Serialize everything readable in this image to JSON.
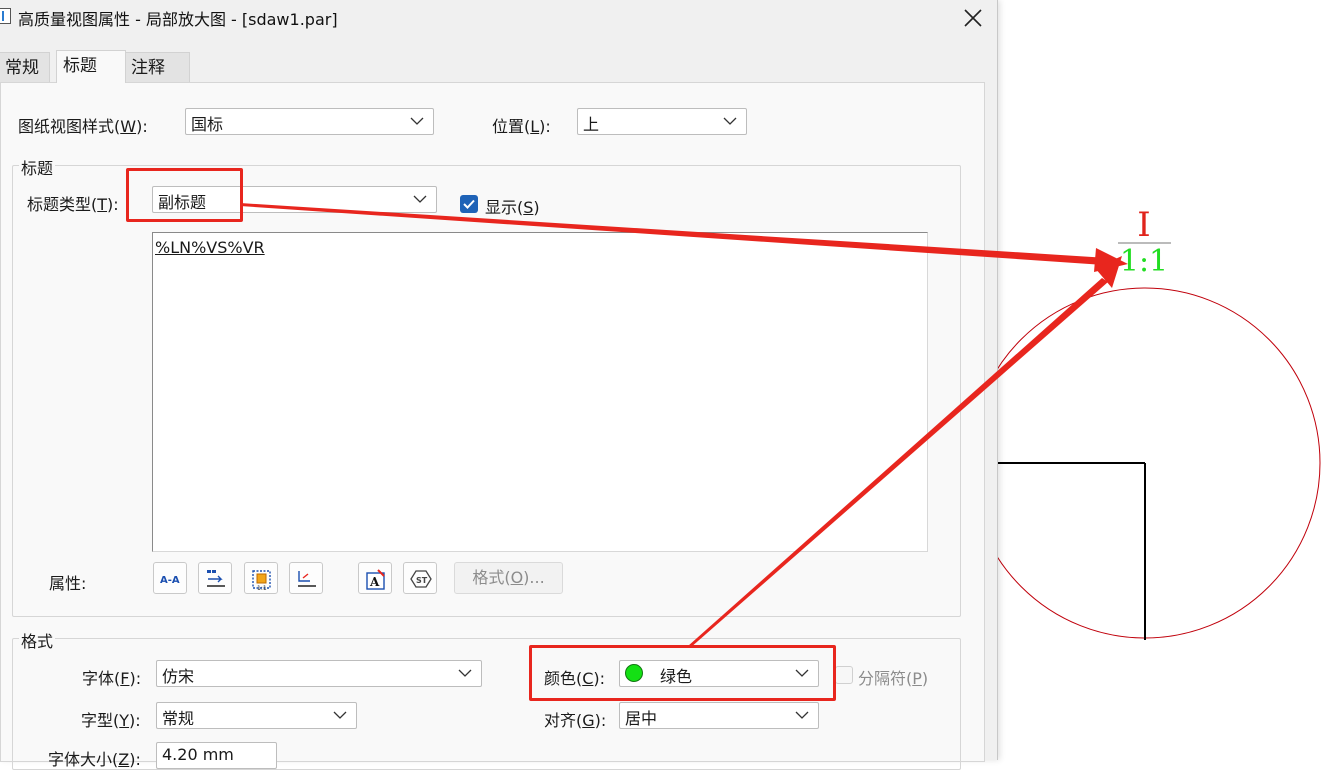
{
  "window": {
    "title": "高质量视图属性 - 局部放大图 - [sdaw1.par]"
  },
  "tabs": [
    {
      "label": "常规",
      "active": false
    },
    {
      "label": "标题",
      "active": true
    },
    {
      "label": "注释",
      "active": false
    }
  ],
  "drawing_view_style": {
    "label": "图纸视图样式(",
    "key": "W",
    "label_end": "):",
    "value": "国标"
  },
  "position": {
    "label": "位置(",
    "key": "L",
    "label_end": "):",
    "value": "上"
  },
  "caption_group": {
    "title": "标题",
    "caption_type": {
      "label": "标题类型(",
      "key": "T",
      "label_end": "):",
      "value": "副标题"
    },
    "show": {
      "label": "显示(",
      "key": "S",
      "label_end": ")",
      "checked": true
    },
    "text": "%LN%VS%VR",
    "properties_label": "属性:",
    "format_button": {
      "label": "格式(",
      "key": "O",
      "label_end": ")..."
    }
  },
  "format_group": {
    "title": "格式",
    "font": {
      "label": "字体(",
      "key": "F",
      "label_end": "):",
      "value": "仿宋"
    },
    "style": {
      "label": "字型(",
      "key": "Y",
      "label_end": "):",
      "value": "常规"
    },
    "size": {
      "label": "字体大小(",
      "key": "Z",
      "label_end": "):",
      "value": "4.20 mm"
    },
    "color": {
      "label": "颜色(",
      "key": "C",
      "label_end": "):",
      "value": "绿色",
      "swatch": "#14e014"
    },
    "separator": {
      "label": "分隔符(",
      "key": "P",
      "label_end": ")",
      "checked": false
    },
    "align": {
      "label": "对齐(",
      "key": "G",
      "label_end": "):",
      "value": "居中"
    }
  },
  "preview": {
    "label_top": "I",
    "label_bottom": "1:1",
    "top_color": "#e0241c",
    "bottom_color": "#22dd22",
    "circle_color": "#c0000b",
    "highlight_color": "#e8261e"
  }
}
